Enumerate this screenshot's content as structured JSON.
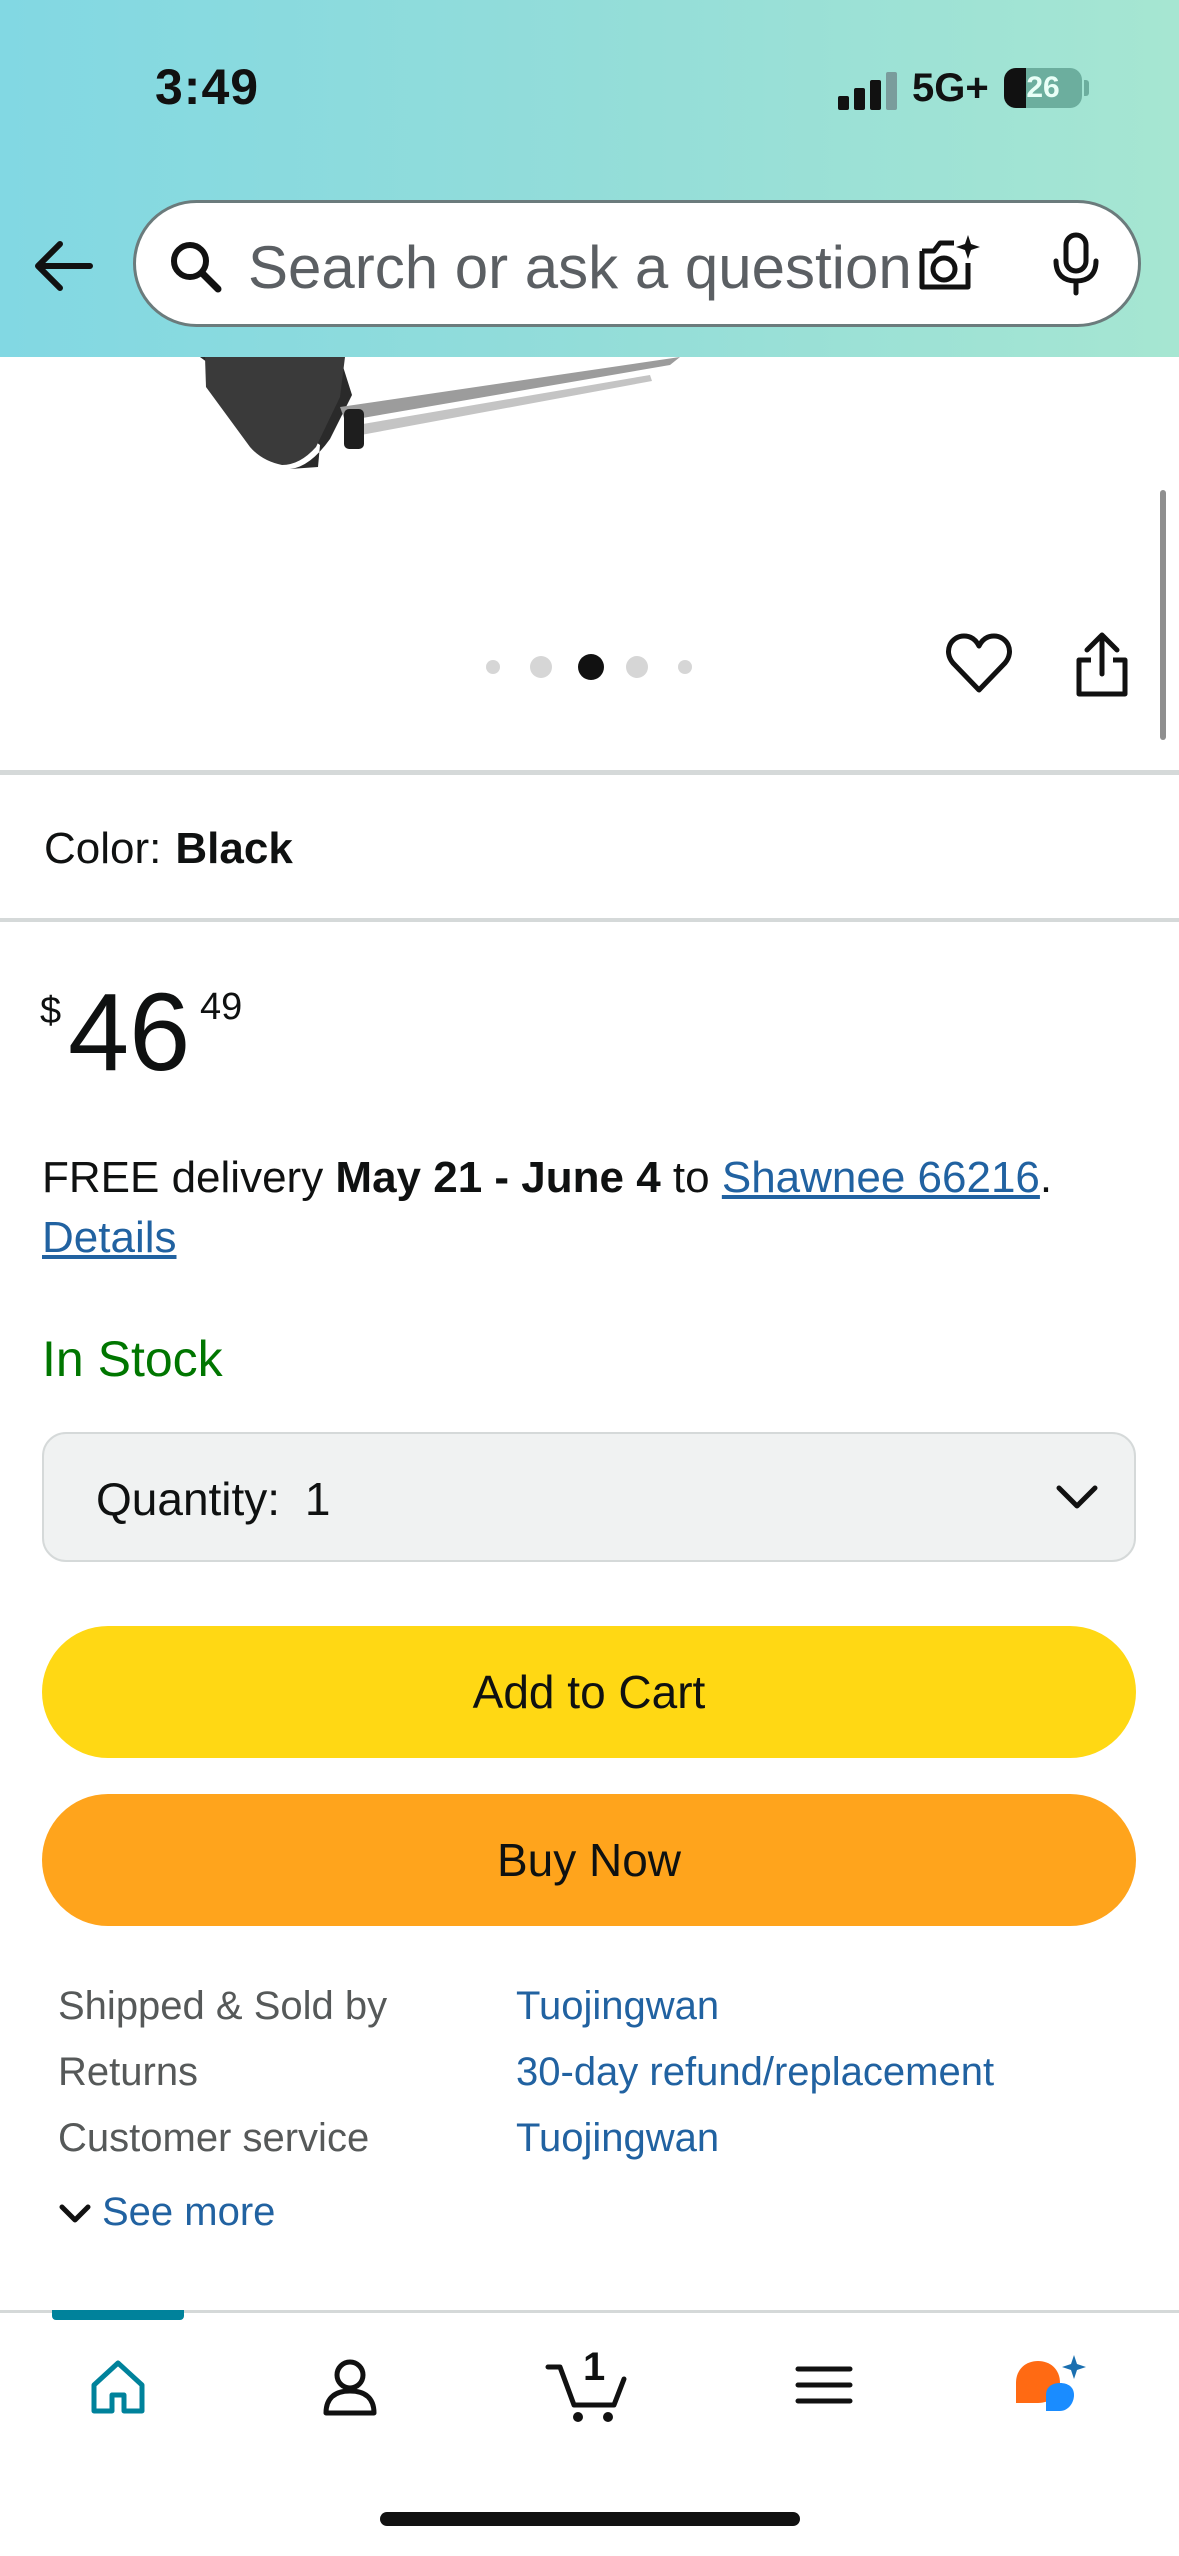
{
  "status_bar": {
    "time": "3:49",
    "network": "5G+",
    "battery": "26"
  },
  "search": {
    "placeholder": "Search or ask a question"
  },
  "product": {
    "image_dots": {
      "count": 5,
      "active_index": 2
    },
    "color_label": "Color:",
    "color_value": "Black",
    "price": {
      "symbol": "$",
      "whole": "46",
      "fraction": "49"
    },
    "delivery": {
      "prefix": "FREE delivery ",
      "dates": "May 21 - June 4",
      "to": " to ",
      "location": "Shawnee 66216",
      "period": ".",
      "details": "Details"
    },
    "availability": "In Stock",
    "quantity_label": "Quantity:",
    "quantity_value": "1",
    "add_to_cart": "Add to Cart",
    "buy_now": "Buy Now",
    "info": [
      {
        "label": "Shipped & Sold by",
        "value": "Tuojingwan"
      },
      {
        "label": "Returns",
        "value": "30-day refund/replacement"
      },
      {
        "label": "Customer service",
        "value": "Tuojingwan"
      }
    ],
    "see_more": "See more"
  },
  "bottom_nav": {
    "items": [
      "home-icon",
      "account-icon",
      "cart-icon",
      "menu-icon",
      "rufus-icon"
    ],
    "active": "home-icon",
    "cart_count": "1"
  },
  "colors": {
    "link": "#2162a1",
    "in_stock": "#007600",
    "add_to_cart": "#ffd814",
    "buy_now": "#ffa41c",
    "nav_active": "#00829b"
  }
}
